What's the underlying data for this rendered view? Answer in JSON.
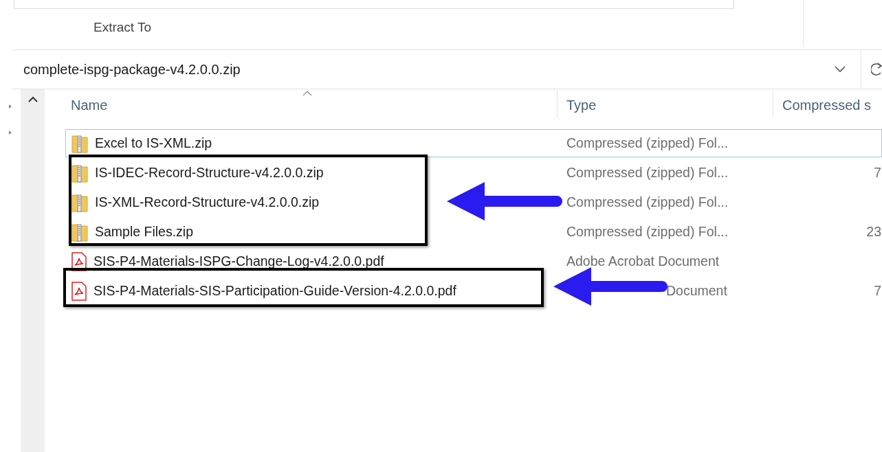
{
  "ribbon": {
    "label": "Extract To"
  },
  "address_bar": {
    "path": "complete-ispg-package-v4.2.0.0.zip"
  },
  "columns": [
    "Name",
    "Type",
    "Compressed s"
  ],
  "files": [
    {
      "name": "Excel to IS-XML.zip",
      "kind": "zip",
      "type": "Compressed (zipped) Fol...",
      "selected": true
    },
    {
      "name": "IS-IDEC-Record-Structure-v4.2.0.0.zip",
      "kind": "zip",
      "type": "Compressed (zipped) Fol...",
      "size": "7",
      "selected": false
    },
    {
      "name": "IS-XML-Record-Structure-v4.2.0.0.zip",
      "kind": "zip",
      "type": "Compressed (zipped) Fol...",
      "selected": false
    },
    {
      "name": "Sample Files.zip",
      "kind": "zip",
      "type": "Compressed (zipped) Fol...",
      "size": "23",
      "selected": false
    },
    {
      "name": "SIS-P4-Materials-ISPG-Change-Log-v4.2.0.0.pdf",
      "kind": "pdf",
      "type": "Adobe Acrobat Document",
      "selected": false
    },
    {
      "name": "SIS-P4-Materials-SIS-Participation-Guide-Version-4.2.0.0.pdf",
      "kind": "pdf",
      "type": "Document",
      "size": "7",
      "selected": false
    }
  ]
}
